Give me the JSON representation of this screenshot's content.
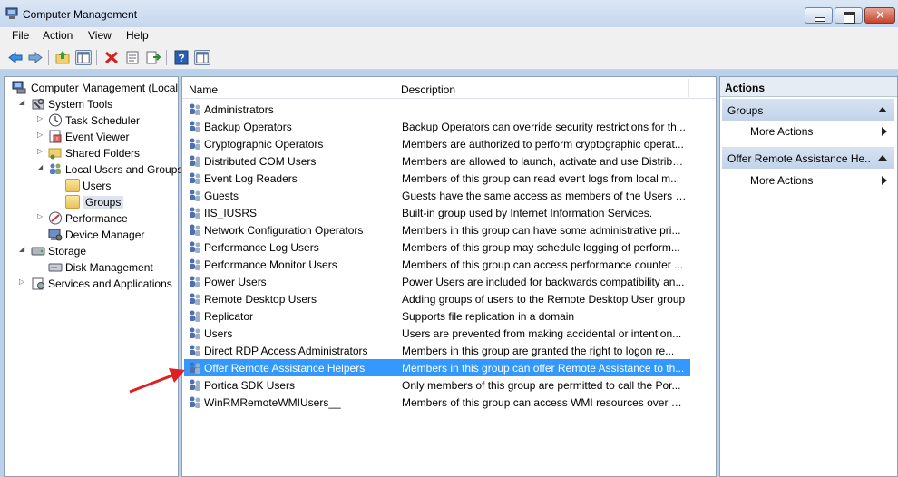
{
  "window": {
    "title": "Computer Management"
  },
  "menu": [
    "File",
    "Action",
    "View",
    "Help"
  ],
  "toolbar": {
    "icons": [
      "back-icon",
      "forward-icon",
      "up-folder-icon",
      "show-hide-tree-icon",
      "delete-icon",
      "properties-icon",
      "export-icon",
      "help-icon",
      "show-action-pane-icon"
    ]
  },
  "tree": {
    "root": "Computer Management (Local",
    "system_tools": "System Tools",
    "task_scheduler": "Task Scheduler",
    "event_viewer": "Event Viewer",
    "shared_folders": "Shared Folders",
    "local_users_groups": "Local Users and Groups",
    "users": "Users",
    "groups": "Groups",
    "performance": "Performance",
    "device_manager": "Device Manager",
    "storage": "Storage",
    "disk_management": "Disk Management",
    "services_apps": "Services and Applications"
  },
  "list": {
    "columns": {
      "name": "Name",
      "description": "Description"
    },
    "rows": [
      {
        "name": "Administrators",
        "description": ""
      },
      {
        "name": "Backup Operators",
        "description": "Backup Operators can override security restrictions for th..."
      },
      {
        "name": "Cryptographic Operators",
        "description": "Members are authorized to perform cryptographic operat..."
      },
      {
        "name": "Distributed COM Users",
        "description": "Members are allowed to launch, activate and use Distribu..."
      },
      {
        "name": "Event Log Readers",
        "description": "Members of this group can read event logs from local m..."
      },
      {
        "name": "Guests",
        "description": "Guests have the same access as members of the Users gr..."
      },
      {
        "name": "IIS_IUSRS",
        "description": "Built-in group used by Internet Information Services."
      },
      {
        "name": "Network Configuration Operators",
        "description": "Members in this group can have some administrative pri..."
      },
      {
        "name": "Performance Log Users",
        "description": "Members of this group may schedule logging of perform..."
      },
      {
        "name": "Performance Monitor Users",
        "description": "Members of this group can access performance counter ..."
      },
      {
        "name": "Power Users",
        "description": "Power Users are included for backwards compatibility an..."
      },
      {
        "name": "Remote Desktop Users",
        "description": "Adding groups of users to the Remote Desktop User group"
      },
      {
        "name": "Replicator",
        "description": "Supports file replication in a domain"
      },
      {
        "name": "Users",
        "description": "Users are prevented from making accidental or intention..."
      },
      {
        "name": "Direct RDP Access Administrators",
        "description": "Members in this group are granted the right to logon re..."
      },
      {
        "name": "Offer Remote Assistance Helpers",
        "description": "Members in this group can offer Remote Assistance to th..."
      },
      {
        "name": "Portica SDK Users",
        "description": "Only members of this group are permitted to call the Por..."
      },
      {
        "name": "WinRMRemoteWMIUsers__",
        "description": "Members of this group can access WMI resources over m..."
      }
    ],
    "selected_index": 15
  },
  "actions": {
    "title": "Actions",
    "section1": "Groups",
    "section1_more": "More Actions",
    "section2": "Offer Remote Assistance He...",
    "section2_more": "More Actions"
  },
  "colors": {
    "selection": "#3399ff",
    "callout_arrow": "#e02020"
  }
}
